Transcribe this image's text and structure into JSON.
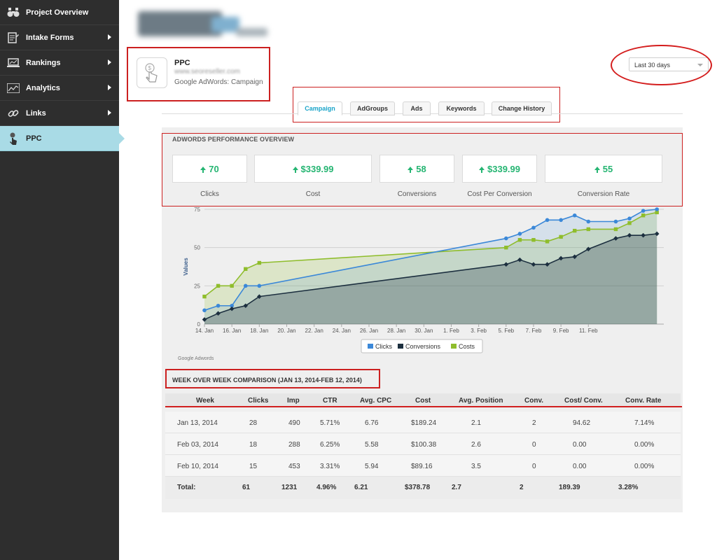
{
  "sidebar": {
    "items": [
      {
        "label": "Project Overview",
        "icon": "binoculars-icon",
        "active": false
      },
      {
        "label": "Intake Forms",
        "icon": "form-icon",
        "active": false
      },
      {
        "label": "Rankings",
        "icon": "laptop-icon",
        "active": false
      },
      {
        "label": "Analytics",
        "icon": "analytics-icon",
        "active": false
      },
      {
        "label": "Links",
        "icon": "link-icon",
        "active": false
      },
      {
        "label": "PPC",
        "icon": "ppc-icon",
        "active": true
      }
    ]
  },
  "header": {
    "title": "PPC",
    "url": "www.seoreseller.com",
    "subtitle": "Google AdWords: Campaign"
  },
  "date_range": {
    "selected": "Last 30 days"
  },
  "tabs": [
    {
      "label": "Campaign",
      "active": true
    },
    {
      "label": "AdGroups",
      "active": false
    },
    {
      "label": "Ads",
      "active": false
    },
    {
      "label": "Keywords",
      "active": false
    },
    {
      "label": "Change History",
      "active": false
    }
  ],
  "overview": {
    "title": "ADWORDS PERFORMANCE OVERVIEW",
    "stats": [
      {
        "value": "70",
        "label": "Clicks"
      },
      {
        "value": "$339.99",
        "label": "Cost"
      },
      {
        "value": "58",
        "label": "Conversions"
      },
      {
        "value": "$339.99",
        "label": "Cost Per Conversion"
      },
      {
        "value": "55",
        "label": "Conversion Rate"
      }
    ]
  },
  "colors": {
    "clicks": "#3b88d8",
    "conversions": "#1c2f3f",
    "costs": "#8fbd2c",
    "accent": "#1aa4c9",
    "positive": "#25b572",
    "highlight": "#d11f1f"
  },
  "chart_data": {
    "type": "line",
    "ylabel": "Values",
    "ylim": [
      0,
      75
    ],
    "yticks": [
      0,
      25,
      50,
      75
    ],
    "xticks": [
      "14. Jan",
      "16. Jan",
      "18. Jan",
      "20. Jan",
      "22. Jan",
      "24. Jan",
      "26. Jan",
      "28. Jan",
      "30. Jan",
      "1. Feb",
      "3. Feb",
      "5. Feb",
      "7. Feb",
      "9. Feb",
      "11. Feb"
    ],
    "x_start": "2014-01-14",
    "grid": true,
    "legend": "bottom-center",
    "credit": "Google Adwords",
    "series": [
      {
        "name": "Clicks",
        "points": [
          [
            0,
            9
          ],
          [
            1,
            12
          ],
          [
            2,
            12
          ],
          [
            3,
            25
          ],
          [
            4,
            25
          ],
          [
            22,
            56
          ],
          [
            23,
            59
          ],
          [
            24,
            63
          ],
          [
            25,
            68
          ],
          [
            26,
            68
          ],
          [
            27,
            71
          ],
          [
            28,
            67
          ],
          [
            30,
            67
          ],
          [
            31,
            69
          ],
          [
            32,
            74
          ],
          [
            33,
            75
          ]
        ]
      },
      {
        "name": "Conversions",
        "points": [
          [
            0,
            3
          ],
          [
            1,
            7
          ],
          [
            2,
            10
          ],
          [
            3,
            12
          ],
          [
            4,
            18
          ],
          [
            22,
            39
          ],
          [
            23,
            42
          ],
          [
            24,
            39
          ],
          [
            25,
            39
          ],
          [
            26,
            43
          ],
          [
            27,
            44
          ],
          [
            28,
            49
          ],
          [
            30,
            56
          ],
          [
            31,
            58
          ],
          [
            32,
            58
          ],
          [
            33,
            59
          ]
        ]
      },
      {
        "name": "Costs",
        "points": [
          [
            0,
            18
          ],
          [
            1,
            25
          ],
          [
            2,
            25
          ],
          [
            3,
            36
          ],
          [
            4,
            40
          ],
          [
            22,
            50
          ],
          [
            23,
            55
          ],
          [
            24,
            55
          ],
          [
            25,
            54
          ],
          [
            26,
            57
          ],
          [
            27,
            61
          ],
          [
            28,
            62
          ],
          [
            30,
            62
          ],
          [
            31,
            66
          ],
          [
            32,
            71
          ],
          [
            33,
            73
          ]
        ]
      }
    ]
  },
  "week": {
    "title": "WEEK OVER WEEK COMPARISON (JAN 13, 2014-FEB 12, 2014)",
    "headers": [
      "Week",
      "Clicks",
      "Imp",
      "CTR",
      "Avg. CPC",
      "Cost",
      "Avg. Position",
      "Conv.",
      "Cost/ Conv.",
      "Conv. Rate"
    ],
    "rows": [
      [
        "Jan 13, 2014",
        "28",
        "490",
        "5.71%",
        "6.76",
        "$189.24",
        "2.1",
        "2",
        "94.62",
        "7.14%"
      ],
      [
        "Feb 03, 2014",
        "18",
        "288",
        "6.25%",
        "5.58",
        "$100.38",
        "2.6",
        "0",
        "0.00",
        "0.00%"
      ],
      [
        "Feb 10, 2014",
        "15",
        "453",
        "3.31%",
        "5.94",
        "$89.16",
        "3.5",
        "0",
        "0.00",
        "0.00%"
      ]
    ],
    "total": [
      "Total:",
      "61",
      "1231",
      "4.96%",
      "6.21",
      "$378.78",
      "2.7",
      "2",
      "189.39",
      "3.28%"
    ]
  }
}
